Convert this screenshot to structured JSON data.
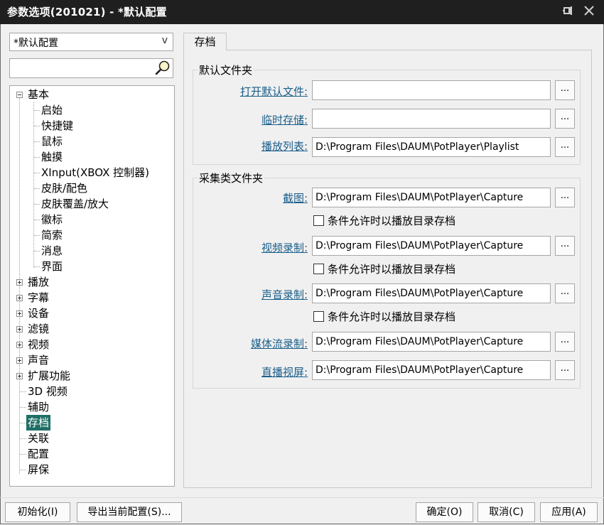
{
  "window": {
    "title": "参数选项(201021) - *默认配置"
  },
  "config_combo": {
    "value": "*默认配置",
    "arrow": "v"
  },
  "search": {
    "value": ""
  },
  "tree": {
    "items": [
      {
        "label": "基本",
        "level": 0,
        "expander": "minus"
      },
      {
        "label": "启始",
        "level": 1
      },
      {
        "label": "快捷键",
        "level": 1
      },
      {
        "label": "鼠标",
        "level": 1
      },
      {
        "label": "触摸",
        "level": 1
      },
      {
        "label": "XInput(XBOX 控制器)",
        "level": 1
      },
      {
        "label": "皮肤/配色",
        "level": 1
      },
      {
        "label": "皮肤覆盖/放大",
        "level": 1
      },
      {
        "label": "徽标",
        "level": 1
      },
      {
        "label": "简索",
        "level": 1
      },
      {
        "label": "消息",
        "level": 1
      },
      {
        "label": "界面",
        "level": 1
      },
      {
        "label": "播放",
        "level": 0,
        "expander": "plus"
      },
      {
        "label": "字幕",
        "level": 0,
        "expander": "plus"
      },
      {
        "label": "设备",
        "level": 0,
        "expander": "plus"
      },
      {
        "label": "滤镜",
        "level": 0,
        "expander": "plus"
      },
      {
        "label": "视频",
        "level": 0,
        "expander": "plus"
      },
      {
        "label": "声音",
        "level": 0,
        "expander": "plus"
      },
      {
        "label": "扩展功能",
        "level": 0,
        "expander": "plus"
      },
      {
        "label": "3D 视频",
        "level": 0
      },
      {
        "label": "辅助",
        "level": 0
      },
      {
        "label": "存档",
        "level": 0,
        "selected": true
      },
      {
        "label": "关联",
        "level": 0
      },
      {
        "label": "配置",
        "level": 0
      },
      {
        "label": "屏保",
        "level": 0
      }
    ]
  },
  "tab": {
    "label": "存档"
  },
  "default_folders": {
    "title": "默认文件夹",
    "open_default_label": "打开默认文件:",
    "open_default_value": "",
    "temp_storage_label": "临时存储:",
    "temp_storage_value": "",
    "playlist_label": "播放列表:",
    "playlist_value": "D:\\Program Files\\DAUM\\PotPlayer\\Playlist"
  },
  "capture_folders": {
    "title": "采集类文件夹",
    "screenshot_label": "截图:",
    "screenshot_value": "D:\\Program Files\\DAUM\\PotPlayer\\Capture",
    "video_rec_label": "视频录制:",
    "video_rec_value": "D:\\Program Files\\DAUM\\PotPlayer\\Capture",
    "audio_rec_label": "声音录制:",
    "audio_rec_value": "D:\\Program Files\\DAUM\\PotPlayer\\Capture",
    "stream_rec_label": "媒体流录制:",
    "stream_rec_value": "D:\\Program Files\\DAUM\\PotPlayer\\Capture",
    "live_screen_label": "直播视屏:",
    "live_screen_value": "D:\\Program Files\\DAUM\\PotPlayer\\Capture",
    "save_in_playlist_dir_label": "条件允许时以播放目录存档"
  },
  "browse_button_label": "...",
  "buttons": {
    "init": "初始化(I)",
    "export": "导出当前配置(S)...",
    "ok": "确定(O)",
    "cancel": "取消(C)",
    "apply": "应用(A)"
  }
}
